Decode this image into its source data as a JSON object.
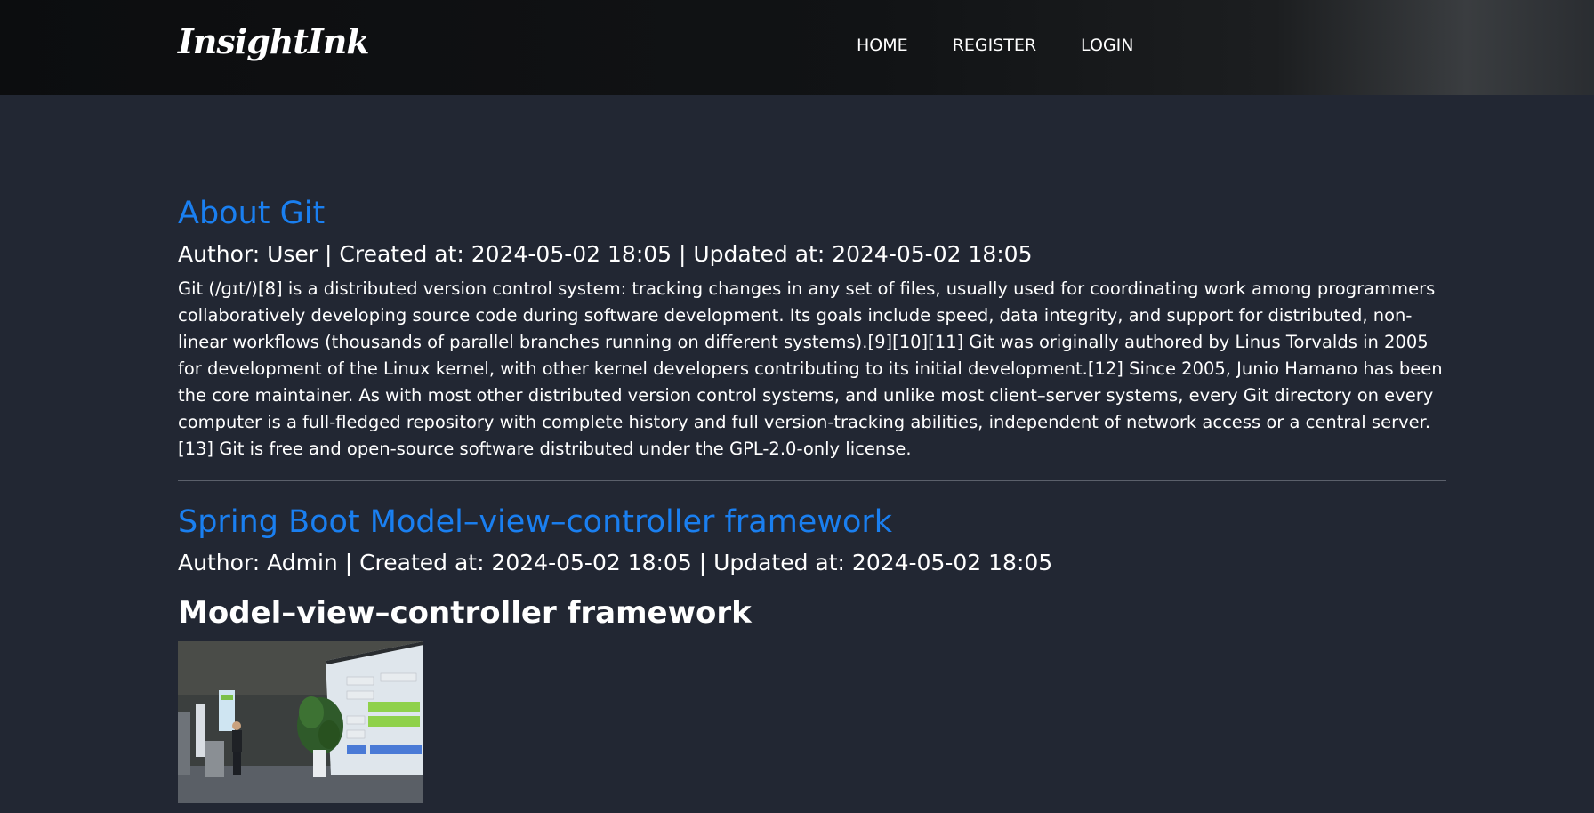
{
  "navbar": {
    "brand": "InsightInk",
    "links": [
      "HOME",
      "REGISTER",
      "LOGIN"
    ]
  },
  "posts": [
    {
      "title": "About Git",
      "meta": "Author: User | Created at: 2024-05-02 18:05 | Updated at: 2024-05-02 18:05",
      "body": "Git (/ɡɪt/)[8] is a distributed version control system: tracking changes in any set of files, usually used for coordinating work among programmers collaboratively developing source code during software development. Its goals include speed, data integrity, and support for distributed, non-linear workflows (thousands of parallel branches running on different systems).[9][10][11] Git was originally authored by Linus Torvalds in 2005 for development of the Linux kernel, with other kernel developers contributing to its initial development.[12] Since 2005, Junio Hamano has been the core maintainer. As with most other distributed version control systems, and unlike most client–server systems, every Git directory on every computer is a full-fledged repository with complete history and full version-tracking abilities, independent of network access or a central server.[13] Git is free and open-source software distributed under the GPL-2.0-only license."
    },
    {
      "title": "Spring Boot Model–view–controller framework",
      "meta": "Author: Admin | Created at: 2024-05-02 18:05 | Updated at: 2024-05-02 18:05",
      "heading": "Model–view–controller framework"
    }
  ],
  "colors": {
    "background": "#222733",
    "link": "#1a7ff0",
    "text": "#ffffff",
    "divider": "#5b606b"
  }
}
